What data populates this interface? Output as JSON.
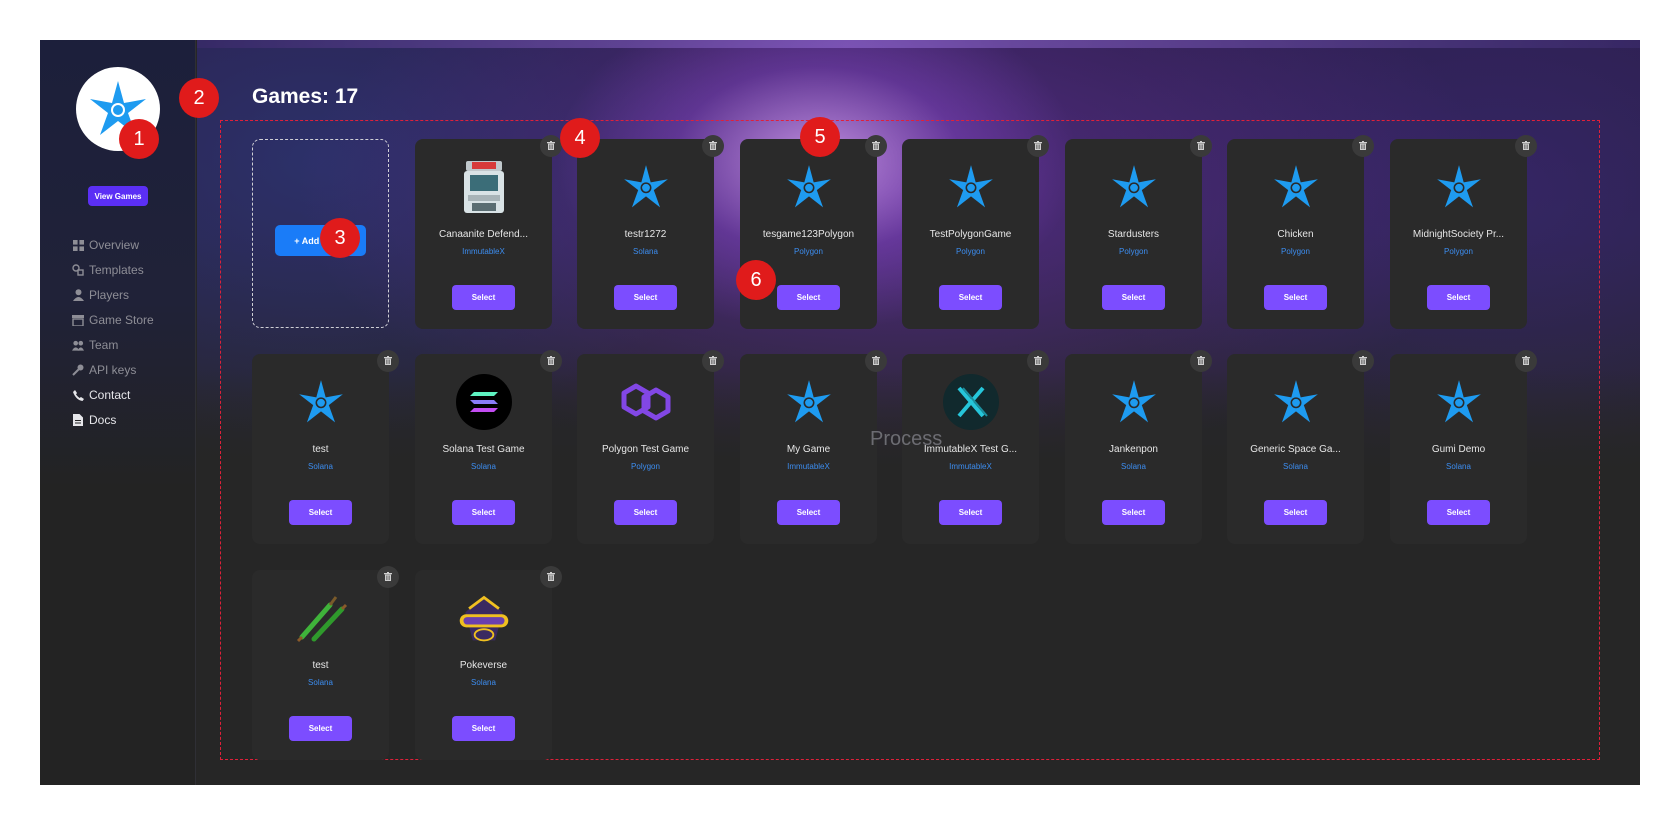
{
  "sidebar": {
    "view_games_label": "View Games",
    "nav": [
      {
        "label": "Overview",
        "icon": "grid-icon"
      },
      {
        "label": "Templates",
        "icon": "shapes-icon"
      },
      {
        "label": "Players",
        "icon": "user-icon"
      },
      {
        "label": "Game Store",
        "icon": "store-icon"
      },
      {
        "label": "Team",
        "icon": "team-icon"
      },
      {
        "label": "API keys",
        "icon": "key-icon"
      },
      {
        "label": "Contact",
        "icon": "phone-icon"
      },
      {
        "label": "Docs",
        "icon": "document-icon"
      }
    ]
  },
  "main": {
    "title": "Games: 17",
    "add_game_label": "+ Add Game",
    "overlay_text": "Process",
    "select_label": "Select",
    "games": [
      {
        "name": "Canaanite Defend...",
        "chain": "ImmutableX",
        "icon": "arcade-machine-icon"
      },
      {
        "name": "testr1272",
        "chain": "Solana",
        "icon": "star-logo-icon"
      },
      {
        "name": "tesgame123Polygon",
        "chain": "Polygon",
        "icon": "star-logo-icon"
      },
      {
        "name": "TestPolygonGame",
        "chain": "Polygon",
        "icon": "star-logo-icon"
      },
      {
        "name": "Stardusters",
        "chain": "Polygon",
        "icon": "star-logo-icon"
      },
      {
        "name": "Chicken",
        "chain": "Polygon",
        "icon": "star-logo-icon"
      },
      {
        "name": "MidnightSociety Pr...",
        "chain": "Polygon",
        "icon": "star-logo-icon"
      },
      {
        "name": "test",
        "chain": "Solana",
        "icon": "star-logo-icon"
      },
      {
        "name": "Solana Test Game",
        "chain": "Solana",
        "icon": "solana-logo-icon"
      },
      {
        "name": "Polygon Test Game",
        "chain": "Polygon",
        "icon": "polygon-logo-icon"
      },
      {
        "name": "My Game",
        "chain": "ImmutableX",
        "icon": "star-logo-icon"
      },
      {
        "name": "ImmutableX Test G...",
        "chain": "ImmutableX",
        "icon": "immutablex-logo-icon"
      },
      {
        "name": "Jankenpon",
        "chain": "Solana",
        "icon": "star-logo-icon"
      },
      {
        "name": "Generic Space Ga...",
        "chain": "Solana",
        "icon": "star-logo-icon"
      },
      {
        "name": "Gumi Demo",
        "chain": "Solana",
        "icon": "star-logo-icon"
      },
      {
        "name": "test",
        "chain": "Solana",
        "icon": "crossed-swords-icon"
      },
      {
        "name": "Pokeverse",
        "chain": "Solana",
        "icon": "pokeverse-logo-icon"
      }
    ]
  },
  "annotations": [
    "1",
    "2",
    "3",
    "4",
    "5",
    "6"
  ],
  "colors": {
    "accent": "#7c4dff",
    "view_games": "#5b2ff5",
    "add_game": "#1a7cf8",
    "chain_text": "#3c8df0",
    "annotation": "#e01b1b",
    "logo_blue": "#1e9bf0"
  }
}
